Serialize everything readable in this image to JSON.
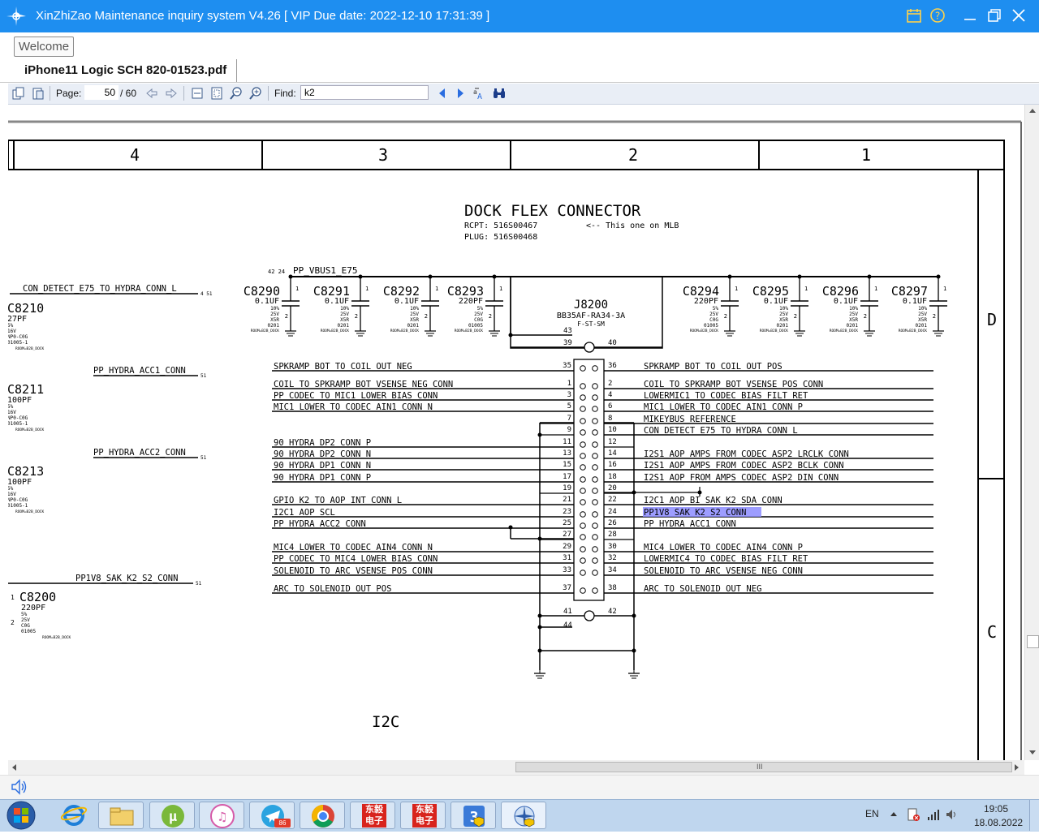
{
  "window": {
    "title": "XinZhiZao Maintenance inquiry system V4.26 [ VIP Due date: 2022-12-10 17:31:39 ]"
  },
  "tabs": {
    "welcome": "Welcome",
    "document": "iPhone11 Logic SCH 820-01523.pdf"
  },
  "toolbar": {
    "page_label": "Page:",
    "page_value": "50",
    "page_total": "/ 60",
    "find_label": "Find:",
    "find_value": "k2"
  },
  "schematic": {
    "zones": [
      "4",
      "3",
      "2",
      "1"
    ],
    "rows": [
      "D",
      "C"
    ],
    "title": "DOCK FLEX CONNECTOR",
    "rcpt": "RCPT: 516S00467",
    "plug": "PLUG: 516S00468",
    "note": "<-- This one on MLB",
    "vbus": "PP_VBUS1_E75",
    "connector_ref": "J8200",
    "connector_part": "BB35AF-RA34-3A",
    "connector_sub": "F-ST-SM",
    "i2c": "I2C",
    "left_nets": [
      "CON_DETECT_E75_TO_HYDRA_CONN_L",
      "PP_HYDRA_ACC1_CONN",
      "PP_HYDRA_ACC2_CONN",
      "PP1V8_SAK_K2_S2_CONN"
    ],
    "left_caps": [
      {
        "ref": "C8210",
        "val": "27PF",
        "l1": "5%",
        "l2": "16V",
        "l3": "NP0-C0G",
        "l4": "01005-1",
        "room": "ROOM=B2B_DOCK"
      },
      {
        "ref": "C8211",
        "val": "100PF",
        "l1": "5%",
        "l2": "16V",
        "l3": "NP0-C0G",
        "l4": "01005-1",
        "room": "ROOM=B2B_DOCK"
      },
      {
        "ref": "C8213",
        "val": "100PF",
        "l1": "5%",
        "l2": "16V",
        "l3": "NP0-C0G",
        "l4": "01005-1",
        "room": "ROOM=B2B_DOCK"
      },
      {
        "ref": "C8200",
        "val": "220PF",
        "l1": "5%",
        "l2": "25V",
        "l3": "C0G",
        "l4": "01005",
        "room": "ROOM=B2B_DOCK"
      }
    ],
    "top_caps": [
      {
        "ref": "C8290",
        "val": "0.1UF",
        "l1": "10%",
        "l2": "25V",
        "l3": "X5R",
        "l4": "0201"
      },
      {
        "ref": "C8291",
        "val": "0.1UF",
        "l1": "10%",
        "l2": "25V",
        "l3": "X5R",
        "l4": "0201"
      },
      {
        "ref": "C8292",
        "val": "0.1UF",
        "l1": "10%",
        "l2": "25V",
        "l3": "X5R",
        "l4": "0201"
      },
      {
        "ref": "C8293",
        "val": "220PF",
        "l1": "5%",
        "l2": "25V",
        "l3": "C0G",
        "l4": "01005"
      },
      {
        "ref": "C8294",
        "val": "220PF",
        "l1": "5%",
        "l2": "25V",
        "l3": "C0G",
        "l4": "01005"
      },
      {
        "ref": "C8295",
        "val": "0.1UF",
        "l1": "10%",
        "l2": "25V",
        "l3": "X5R",
        "l4": "0201"
      },
      {
        "ref": "C8296",
        "val": "0.1UF",
        "l1": "10%",
        "l2": "25V",
        "l3": "X5R",
        "l4": "0201"
      },
      {
        "ref": "C8297",
        "val": "0.1UF",
        "l1": "10%",
        "l2": "25V",
        "l3": "X5R",
        "l4": "0201"
      }
    ],
    "room": "ROOM=B2B_DOCK",
    "left_pins": [
      {
        "pin": "35",
        "net": "SPKRAMP_BOT_TO_COIL_OUT_NEG"
      },
      {
        "pin": "1",
        "net": "COIL_TO_SPKRAMP_BOT_VSENSE_NEG_CONN"
      },
      {
        "pin": "3",
        "net": "PP_CODEC_TO_MIC1_LOWER_BIAS_CONN"
      },
      {
        "pin": "5",
        "net": "MIC1_LOWER_TO_CODEC_AIN1_CONN_N"
      },
      {
        "pin": "7",
        "net": ""
      },
      {
        "pin": "9",
        "net": ""
      },
      {
        "pin": "11",
        "net": "90_HYDRA_DP2_CONN_P"
      },
      {
        "pin": "13",
        "net": "90_HYDRA_DP2_CONN_N"
      },
      {
        "pin": "15",
        "net": "90_HYDRA_DP1_CONN_N"
      },
      {
        "pin": "17",
        "net": "90_HYDRA_DP1_CONN_P"
      },
      {
        "pin": "19",
        "net": ""
      },
      {
        "pin": "21",
        "net": "GPIO_K2_TO_AOP_INT_CONN_L"
      },
      {
        "pin": "23",
        "net": "I2C1_AOP_SCL"
      },
      {
        "pin": "25",
        "net": "PP_HYDRA_ACC2_CONN"
      },
      {
        "pin": "27",
        "net": ""
      },
      {
        "pin": "29",
        "net": "MIC4_LOWER_TO_CODEC_AIN4_CONN_N"
      },
      {
        "pin": "31",
        "net": "PP_CODEC_TO_MIC4_LOWER_BIAS_CONN"
      },
      {
        "pin": "33",
        "net": "SOLENOID_TO_ARC_VSENSE_POS_CONN"
      },
      {
        "pin": "37",
        "net": "ARC_TO_SOLENOID_OUT_POS"
      }
    ],
    "right_pins": [
      {
        "pin": "36",
        "net": "SPKRAMP_BOT_TO_COIL_OUT_POS"
      },
      {
        "pin": "2",
        "net": "COIL_TO_SPKRAMP_BOT_VSENSE_POS_CONN"
      },
      {
        "pin": "4",
        "net": "LOWERMIC1_TO_CODEC_BIAS_FILT_RET"
      },
      {
        "pin": "6",
        "net": "MIC1_LOWER_TO_CODEC_AIN1_CONN_P"
      },
      {
        "pin": "8",
        "net": "MIKEYBUS_REFERENCE"
      },
      {
        "pin": "10",
        "net": "CON_DETECT_E75_TO_HYDRA_CONN_L"
      },
      {
        "pin": "12",
        "net": ""
      },
      {
        "pin": "14",
        "net": "I2S1_AOP_AMPS_FROM_CODEC_ASP2_LRCLK_CONN"
      },
      {
        "pin": "16",
        "net": "I2S1_AOP_AMPS_FROM_CODEC_ASP2_BCLK_CONN"
      },
      {
        "pin": "18",
        "net": "I2S1_AOP_FROM_AMPS_CODEC_ASP2_DIN_CONN"
      },
      {
        "pin": "20",
        "net": ""
      },
      {
        "pin": "22",
        "net": "I2C1_AOP_BI_SAK_K2_SDA_CONN"
      },
      {
        "pin": "24",
        "net": "PP1V8_SAK_K2_S2_CONN"
      },
      {
        "pin": "26",
        "net": "PP_HYDRA_ACC1_CONN"
      },
      {
        "pin": "28",
        "net": ""
      },
      {
        "pin": "30",
        "net": "MIC4_LOWER_TO_CODEC_AIN4_CONN_P"
      },
      {
        "pin": "32",
        "net": "LOWERMIC4_TO_CODEC_BIAS_FILT_RET"
      },
      {
        "pin": "34",
        "net": "SOLENOID_TO_ARC_VSENSE_NEG_CONN"
      },
      {
        "pin": "38",
        "net": "ARC_TO_SOLENOID_OUT_NEG"
      }
    ],
    "extra_pins": {
      "p43": "43",
      "p39": "39",
      "p40": "40",
      "p41": "41",
      "p42": "42",
      "p44": "44"
    },
    "highlight_color": "#8c8cff"
  },
  "taskbar": {
    "lang": "EN",
    "time": "19:05",
    "date": "18.08.2022",
    "telegram_badge": "86",
    "dongyi_label_1": "东毅",
    "dongyi_label_2": "电子",
    "scroll_label": "III"
  }
}
